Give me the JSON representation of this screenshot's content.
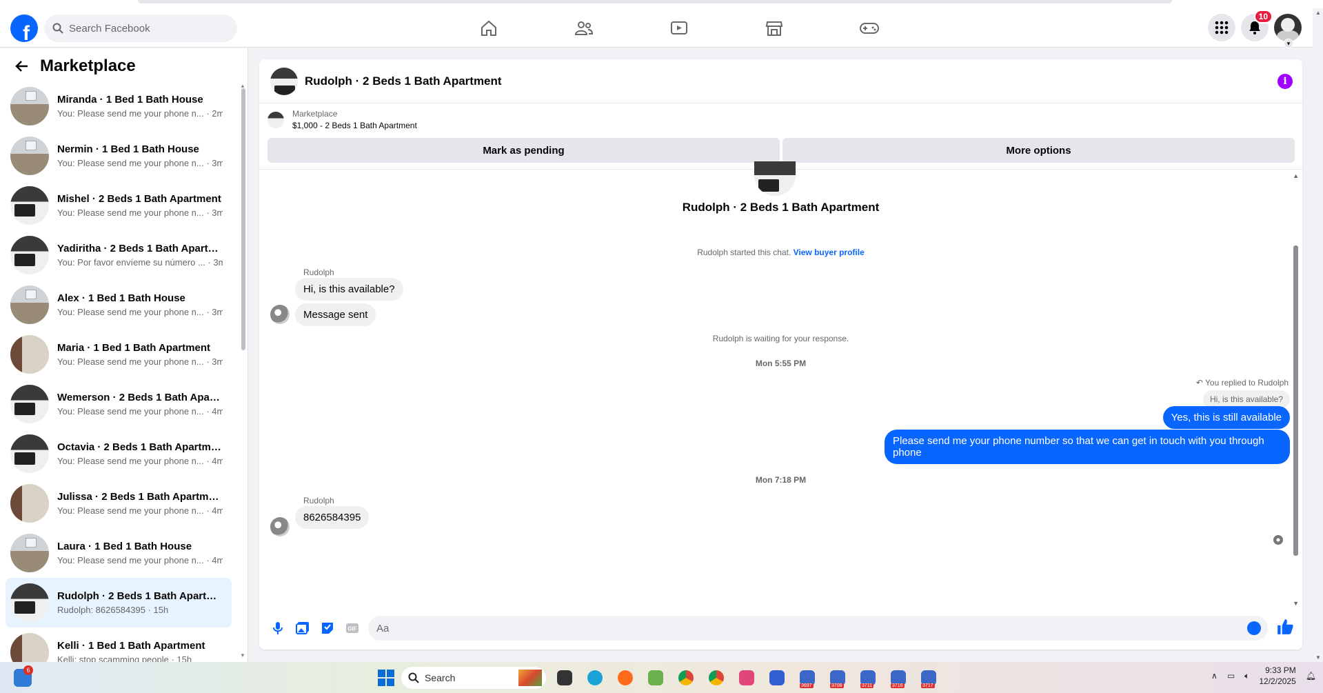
{
  "header": {
    "logo_letter": "f",
    "search_placeholder": "Search Facebook",
    "notification_count": "10"
  },
  "sidebar": {
    "title": "Marketplace",
    "conversations": [
      {
        "title": "Miranda · 1 Bed 1 Bath House",
        "preview": "You: Please send me your phone n... · 2m",
        "thumb": "room"
      },
      {
        "title": "Nermin · 1 Bed 1 Bath House",
        "preview": "You: Please send me your phone n... · 3m",
        "thumb": "room"
      },
      {
        "title": "Mishel · 2 Beds 1 Bath Apartment",
        "preview": "You: Please send me your phone n... · 3m",
        "thumb": "kitchen"
      },
      {
        "title": "Yadiritha · 2 Beds 1 Bath Apartm...",
        "preview": "You: Por favor envíeme su número ... · 3m",
        "thumb": "kitchen"
      },
      {
        "title": "Alex · 1 Bed 1 Bath House",
        "preview": "You: Please send me your phone n... · 3m",
        "thumb": "room"
      },
      {
        "title": "Maria · 1 Bed 1 Bath Apartment",
        "preview": "You: Please send me your phone n... · 3m",
        "thumb": "door"
      },
      {
        "title": "Wemerson · 2 Beds 1 Bath Apart...",
        "preview": "You: Please send me your phone n... · 4m",
        "thumb": "kitchen"
      },
      {
        "title": "Octavia · 2 Beds 1 Bath Apartment",
        "preview": "You: Please send me your phone n... · 4m",
        "thumb": "kitchen"
      },
      {
        "title": "Julissa · 2 Beds 1 Bath Apartment",
        "preview": "You: Please send me your phone n... · 4m",
        "thumb": "door"
      },
      {
        "title": "Laura · 1 Bed 1 Bath House",
        "preview": "You: Please send me your phone n... · 4m",
        "thumb": "room"
      },
      {
        "title": "Rudolph · 2 Beds 1 Bath Apartm...",
        "preview": "Rudolph: 8626584395 · 15h",
        "thumb": "kitchen",
        "active": true
      },
      {
        "title": "Kelli · 1 Bed 1 Bath Apartment",
        "preview": "Kelli: stop scamming people · 15h",
        "thumb": "door"
      }
    ]
  },
  "chat": {
    "title": "Rudolph · 2 Beds 1 Bath Apartment",
    "listing_source": "Marketplace",
    "listing_price_title": "$1,000 - 2 Beds 1 Bath Apartment",
    "btn_pending": "Mark as pending",
    "btn_more": "More options",
    "intro_name": "Rudolph · 2 Beds 1 Bath Apartment",
    "started_text": "Rudolph started this chat.",
    "view_profile": "View buyer profile",
    "sender_name": "Rudolph",
    "msg1": "Hi, is this available?",
    "msg2": "Message sent",
    "waiting": "Rudolph is waiting for your response.",
    "time1": "Mon 5:55 PM",
    "replied_label": "You replied to Rudolph",
    "replied_quote": "Hi, is this available?",
    "my_msg1": "Yes, this is still available",
    "my_msg2": "Please send me your phone  number so that we can get in touch with you through phone",
    "time2": "Mon 7:18 PM",
    "sender_name2": "Rudolph",
    "msg3": "8626584395",
    "composer_placeholder": "Aa"
  },
  "taskbar": {
    "widget_badge": "6",
    "search_label": "Search",
    "app_counts": [
      "3697",
      "3708",
      "3711",
      "3716",
      "3717"
    ],
    "time": "9:33 PM",
    "date": "12/2/2025"
  },
  "colors": {
    "brand_blue": "#0866ff",
    "info_purple": "#a200ff",
    "badge_red": "#e41e3f"
  }
}
